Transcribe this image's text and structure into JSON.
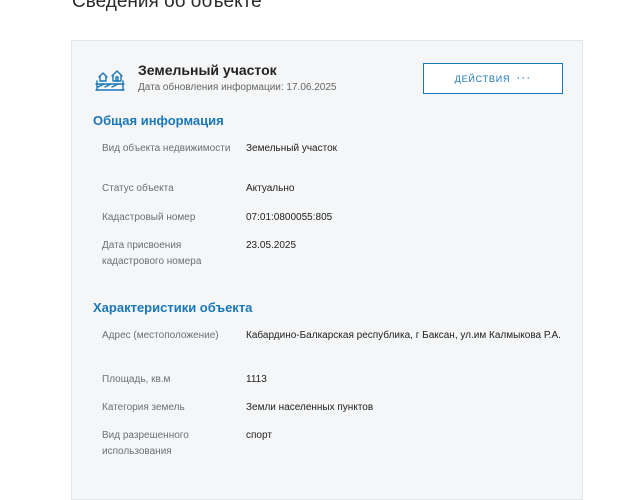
{
  "page": {
    "title": "Сведения об объекте"
  },
  "object": {
    "icon": "land-plot-icon",
    "title": "Земельный участок",
    "date_label": "Дата обновления информации: 17.06.2025",
    "actions_label": "ДЕЙСТВИЯ",
    "actions_dots": "···"
  },
  "general": {
    "title": "Общая информация",
    "rows": [
      {
        "label": "Вид объекта недвижимости",
        "value": "Земельный участок"
      },
      {
        "label": "Статус объекта",
        "value": "Актуально"
      },
      {
        "label": "Кадастровый номер",
        "value": "07:01:0800055:805"
      },
      {
        "label": "Дата присвоения кадастрового номера",
        "value": "23.05.2025"
      }
    ]
  },
  "characteristics": {
    "title": "Характеристики объекта",
    "rows": [
      {
        "label": "Адрес (местоположение)",
        "value": "Кабардино-Балкарская республика, г Баксан, ул.им Калмыкова Р.А."
      },
      {
        "label": "Площадь, кв.м",
        "value": "1113"
      },
      {
        "label": "Категория земель",
        "value": "Земли населенных пунктов"
      },
      {
        "label": "Вид разрешенного использования",
        "value": "спорт"
      }
    ]
  },
  "colors": {
    "accent": "#1a77b8",
    "card_bg": "#f5f6f7"
  }
}
